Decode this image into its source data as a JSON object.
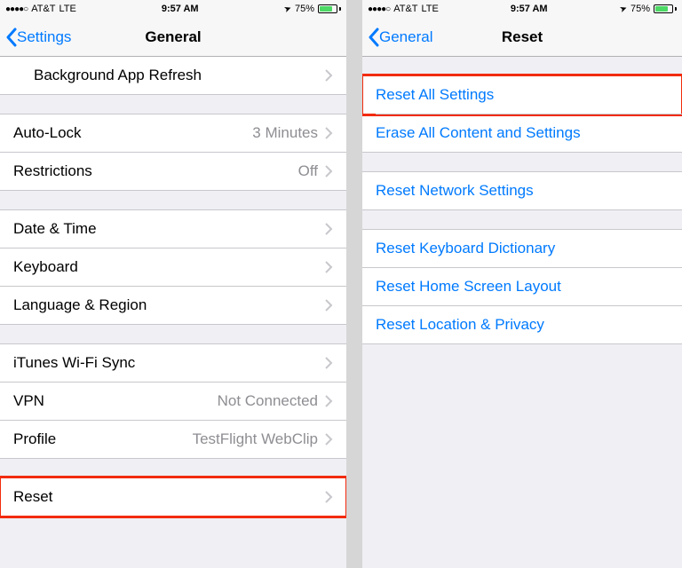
{
  "status": {
    "carrier": "AT&T",
    "network": "LTE",
    "time": "9:57 AM",
    "battery_pct": "75%",
    "location_icon": "➤"
  },
  "left": {
    "back_label": "Settings",
    "title": "General",
    "rows": {
      "bg_refresh": "Background App Refresh",
      "auto_lock": "Auto-Lock",
      "auto_lock_value": "3 Minutes",
      "restrictions": "Restrictions",
      "restrictions_value": "Off",
      "date_time": "Date & Time",
      "keyboard": "Keyboard",
      "lang_region": "Language & Region",
      "itunes_wifi": "iTunes Wi-Fi Sync",
      "vpn": "VPN",
      "vpn_value": "Not Connected",
      "profile": "Profile",
      "profile_value": "TestFlight WebClip",
      "reset": "Reset"
    }
  },
  "right": {
    "back_label": "General",
    "title": "Reset",
    "rows": {
      "reset_all": "Reset All Settings",
      "erase_all": "Erase All Content and Settings",
      "reset_network": "Reset Network Settings",
      "reset_keyboard": "Reset Keyboard Dictionary",
      "reset_home": "Reset Home Screen Layout",
      "reset_location": "Reset Location & Privacy"
    }
  }
}
